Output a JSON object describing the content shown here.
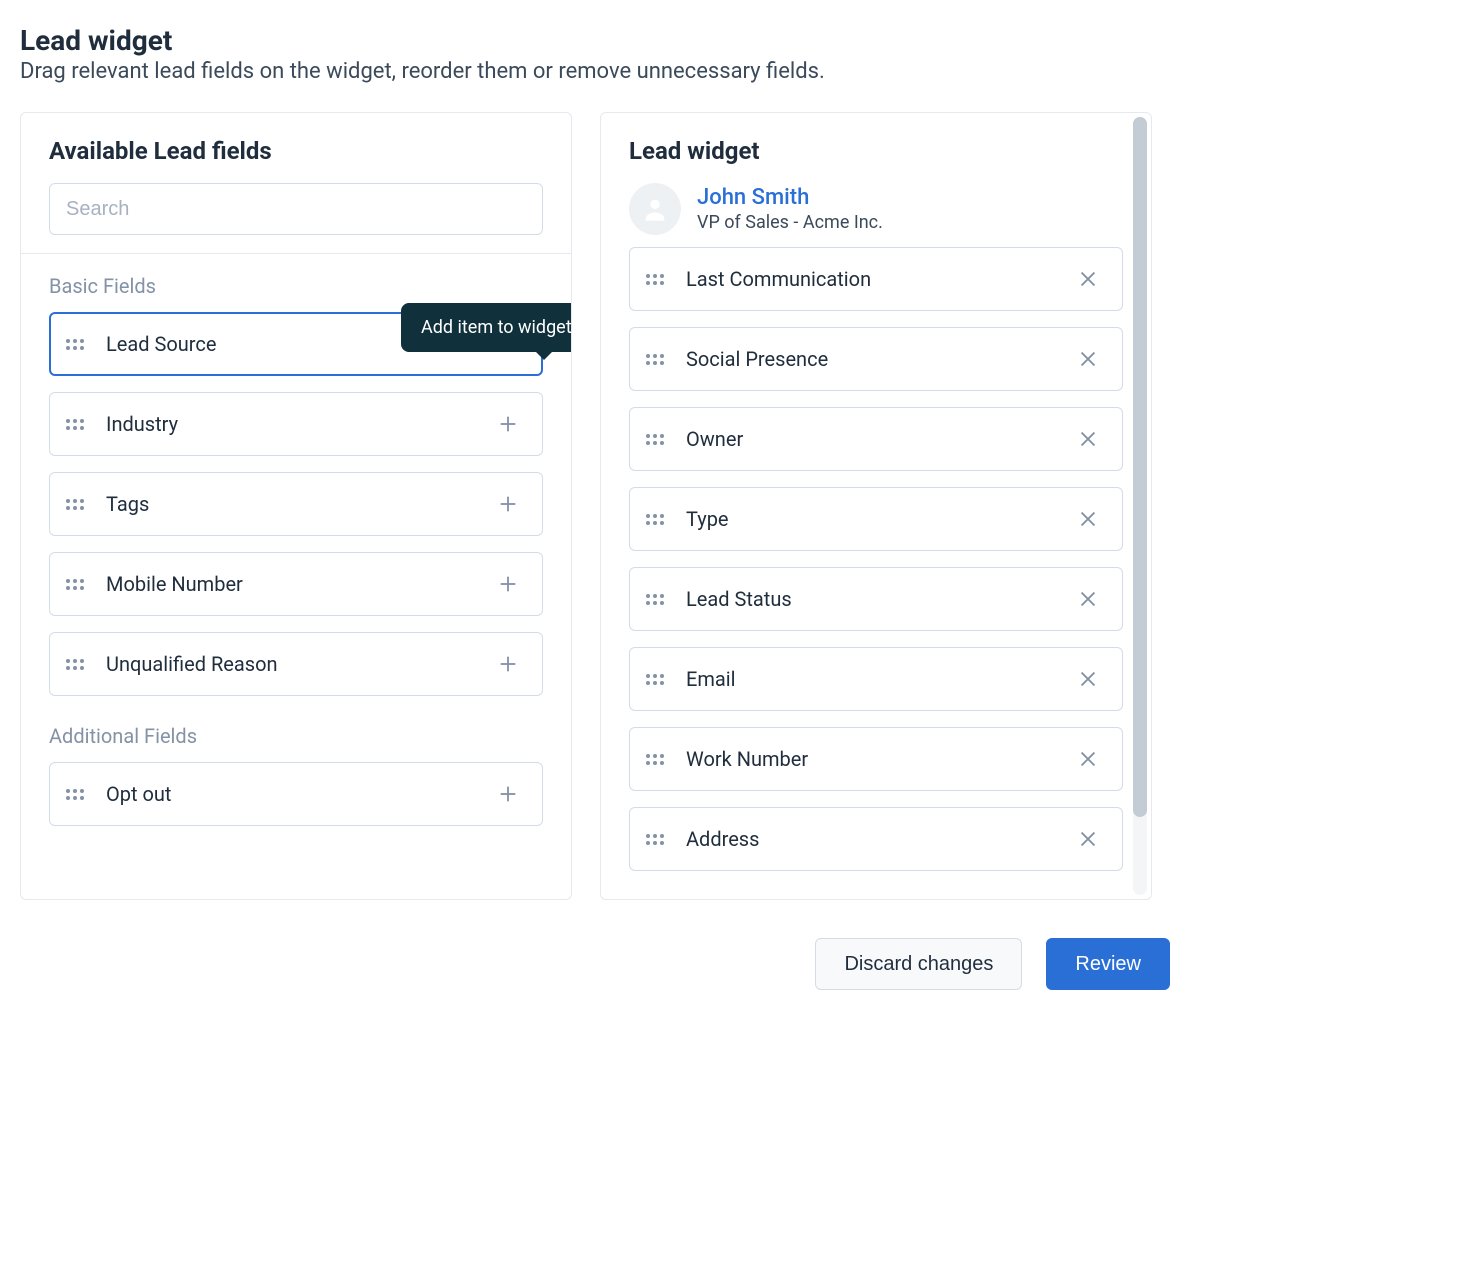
{
  "page": {
    "title": "Lead widget",
    "subtitle": "Drag relevant lead fields on the widget, reorder them or remove unnecessary fields."
  },
  "tooltip": {
    "add_item": "Add item to widget"
  },
  "left_panel": {
    "title": "Available Lead fields",
    "search_placeholder": "Search",
    "sections": [
      {
        "label": "Basic Fields",
        "items": [
          {
            "label": "Lead Source",
            "highlight": true
          },
          {
            "label": "Industry",
            "highlight": false
          },
          {
            "label": "Tags",
            "highlight": false
          },
          {
            "label": "Mobile Number",
            "highlight": false
          },
          {
            "label": "Unqualified Reason",
            "highlight": false
          }
        ]
      },
      {
        "label": "Additional Fields",
        "items": [
          {
            "label": "Opt out",
            "highlight": false
          }
        ]
      }
    ]
  },
  "right_panel": {
    "title": "Lead widget",
    "lead": {
      "name": "John Smith",
      "subtitle": "VP of Sales - Acme Inc."
    },
    "items": [
      {
        "label": "Last Communication"
      },
      {
        "label": "Social Presence"
      },
      {
        "label": "Owner"
      },
      {
        "label": "Type"
      },
      {
        "label": "Lead Status"
      },
      {
        "label": "Email"
      },
      {
        "label": "Work Number"
      },
      {
        "label": "Address"
      }
    ]
  },
  "footer": {
    "discard": "Discard changes",
    "review": "Review"
  }
}
